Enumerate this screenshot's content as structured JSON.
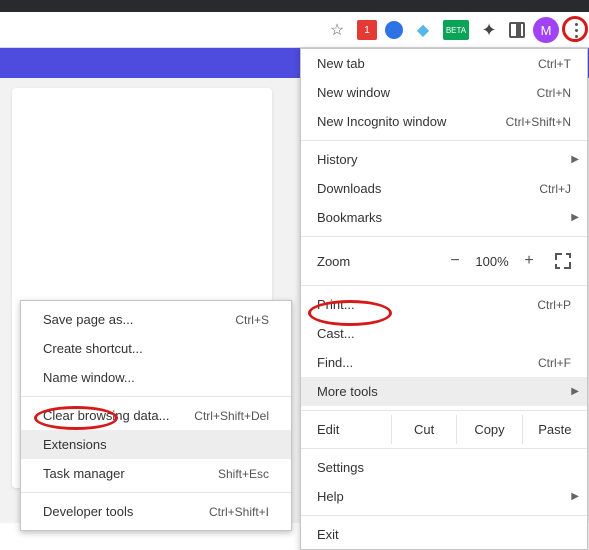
{
  "toolbar": {
    "star_icon": "star",
    "ext_red_label": "1",
    "ext_beta_label": "BETA",
    "avatar_letter": "M"
  },
  "menu": {
    "new_tab": "New tab",
    "new_tab_s": "Ctrl+T",
    "new_window": "New window",
    "new_window_s": "Ctrl+N",
    "incognito": "New Incognito window",
    "incognito_s": "Ctrl+Shift+N",
    "history": "History",
    "downloads": "Downloads",
    "downloads_s": "Ctrl+J",
    "bookmarks": "Bookmarks",
    "zoom": "Zoom",
    "zoom_minus": "−",
    "zoom_val": "100%",
    "zoom_plus": "+",
    "print": "Print...",
    "print_s": "Ctrl+P",
    "cast": "Cast...",
    "find": "Find...",
    "find_s": "Ctrl+F",
    "more_tools": "More tools",
    "edit": "Edit",
    "cut": "Cut",
    "copy": "Copy",
    "paste": "Paste",
    "settings": "Settings",
    "help": "Help",
    "exit": "Exit"
  },
  "submenu": {
    "save_page": "Save page as...",
    "save_page_s": "Ctrl+S",
    "create_shortcut": "Create shortcut...",
    "name_window": "Name window...",
    "clear_data": "Clear browsing data...",
    "clear_data_s": "Ctrl+Shift+Del",
    "extensions": "Extensions",
    "task_manager": "Task manager",
    "task_manager_s": "Shift+Esc",
    "dev_tools": "Developer tools",
    "dev_tools_s": "Ctrl+Shift+I"
  }
}
